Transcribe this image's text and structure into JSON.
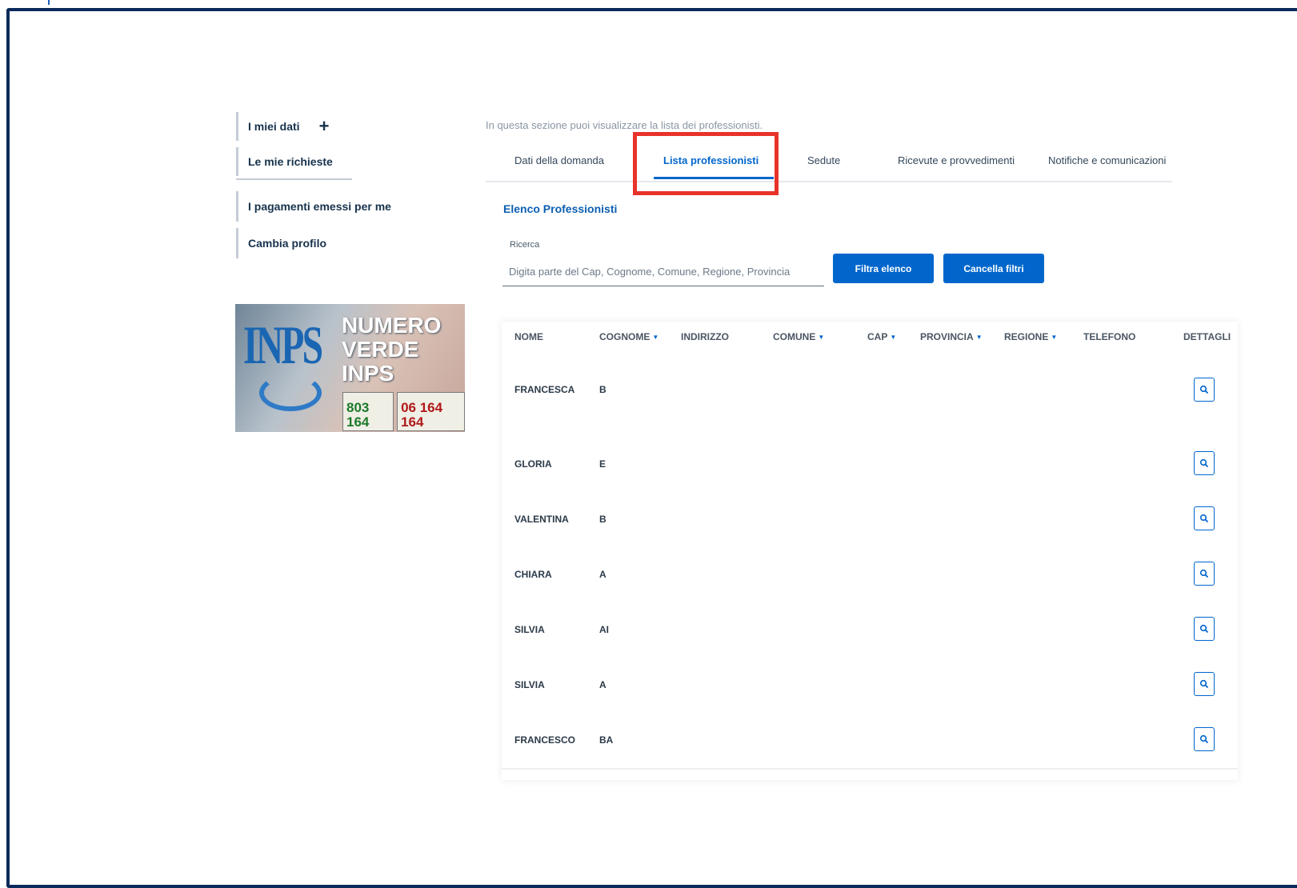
{
  "sidebar": {
    "items": [
      {
        "label": "I miei dati"
      },
      {
        "label": "Le mie richieste"
      },
      {
        "label": "I pagamenti emessi per me"
      },
      {
        "label": "Cambia profilo"
      }
    ]
  },
  "banner": {
    "logo": "INPS",
    "line1": "NUMERO",
    "line2": "VERDE",
    "line3": "INPS",
    "number1": "803 164",
    "number2": "06 164 164"
  },
  "main": {
    "intro": "In questa sezione puoi visualizzare la lista dei professionisti.",
    "tabs": [
      {
        "label": "Dati della domanda"
      },
      {
        "label": "Lista professionisti"
      },
      {
        "label": "Sedute"
      },
      {
        "label": "Ricevute e provvedimenti"
      },
      {
        "label": "Notifiche e comunicazioni"
      }
    ],
    "section_title": "Elenco Professionisti",
    "search": {
      "label": "Ricerca",
      "placeholder": "Digita parte del Cap, Cognome, Comune, Regione, Provincia"
    },
    "buttons": {
      "filter": "Filtra elenco",
      "clear": "Cancella filtri"
    }
  },
  "table": {
    "columns": [
      "NOME",
      "COGNOME",
      "INDIRIZZO",
      "COMUNE",
      "CAP",
      "PROVINCIA",
      "REGIONE",
      "TELEFONO",
      "DETTAGLI"
    ],
    "rows": [
      {
        "nome": "FRANCESCA",
        "cognome": "B"
      },
      {
        "nome": "GLORIA",
        "cognome": "E"
      },
      {
        "nome": "VALENTINA",
        "cognome": "B"
      },
      {
        "nome": "CHIARA",
        "cognome": "A"
      },
      {
        "nome": "SILVIA",
        "cognome": "AI"
      },
      {
        "nome": "SILVIA",
        "cognome": "A"
      },
      {
        "nome": "FRANCESCO",
        "cognome": "BA"
      }
    ]
  },
  "colors": {
    "accent": "#0066cc",
    "highlight": "#e8332a",
    "frame": "#0b2a5b"
  }
}
